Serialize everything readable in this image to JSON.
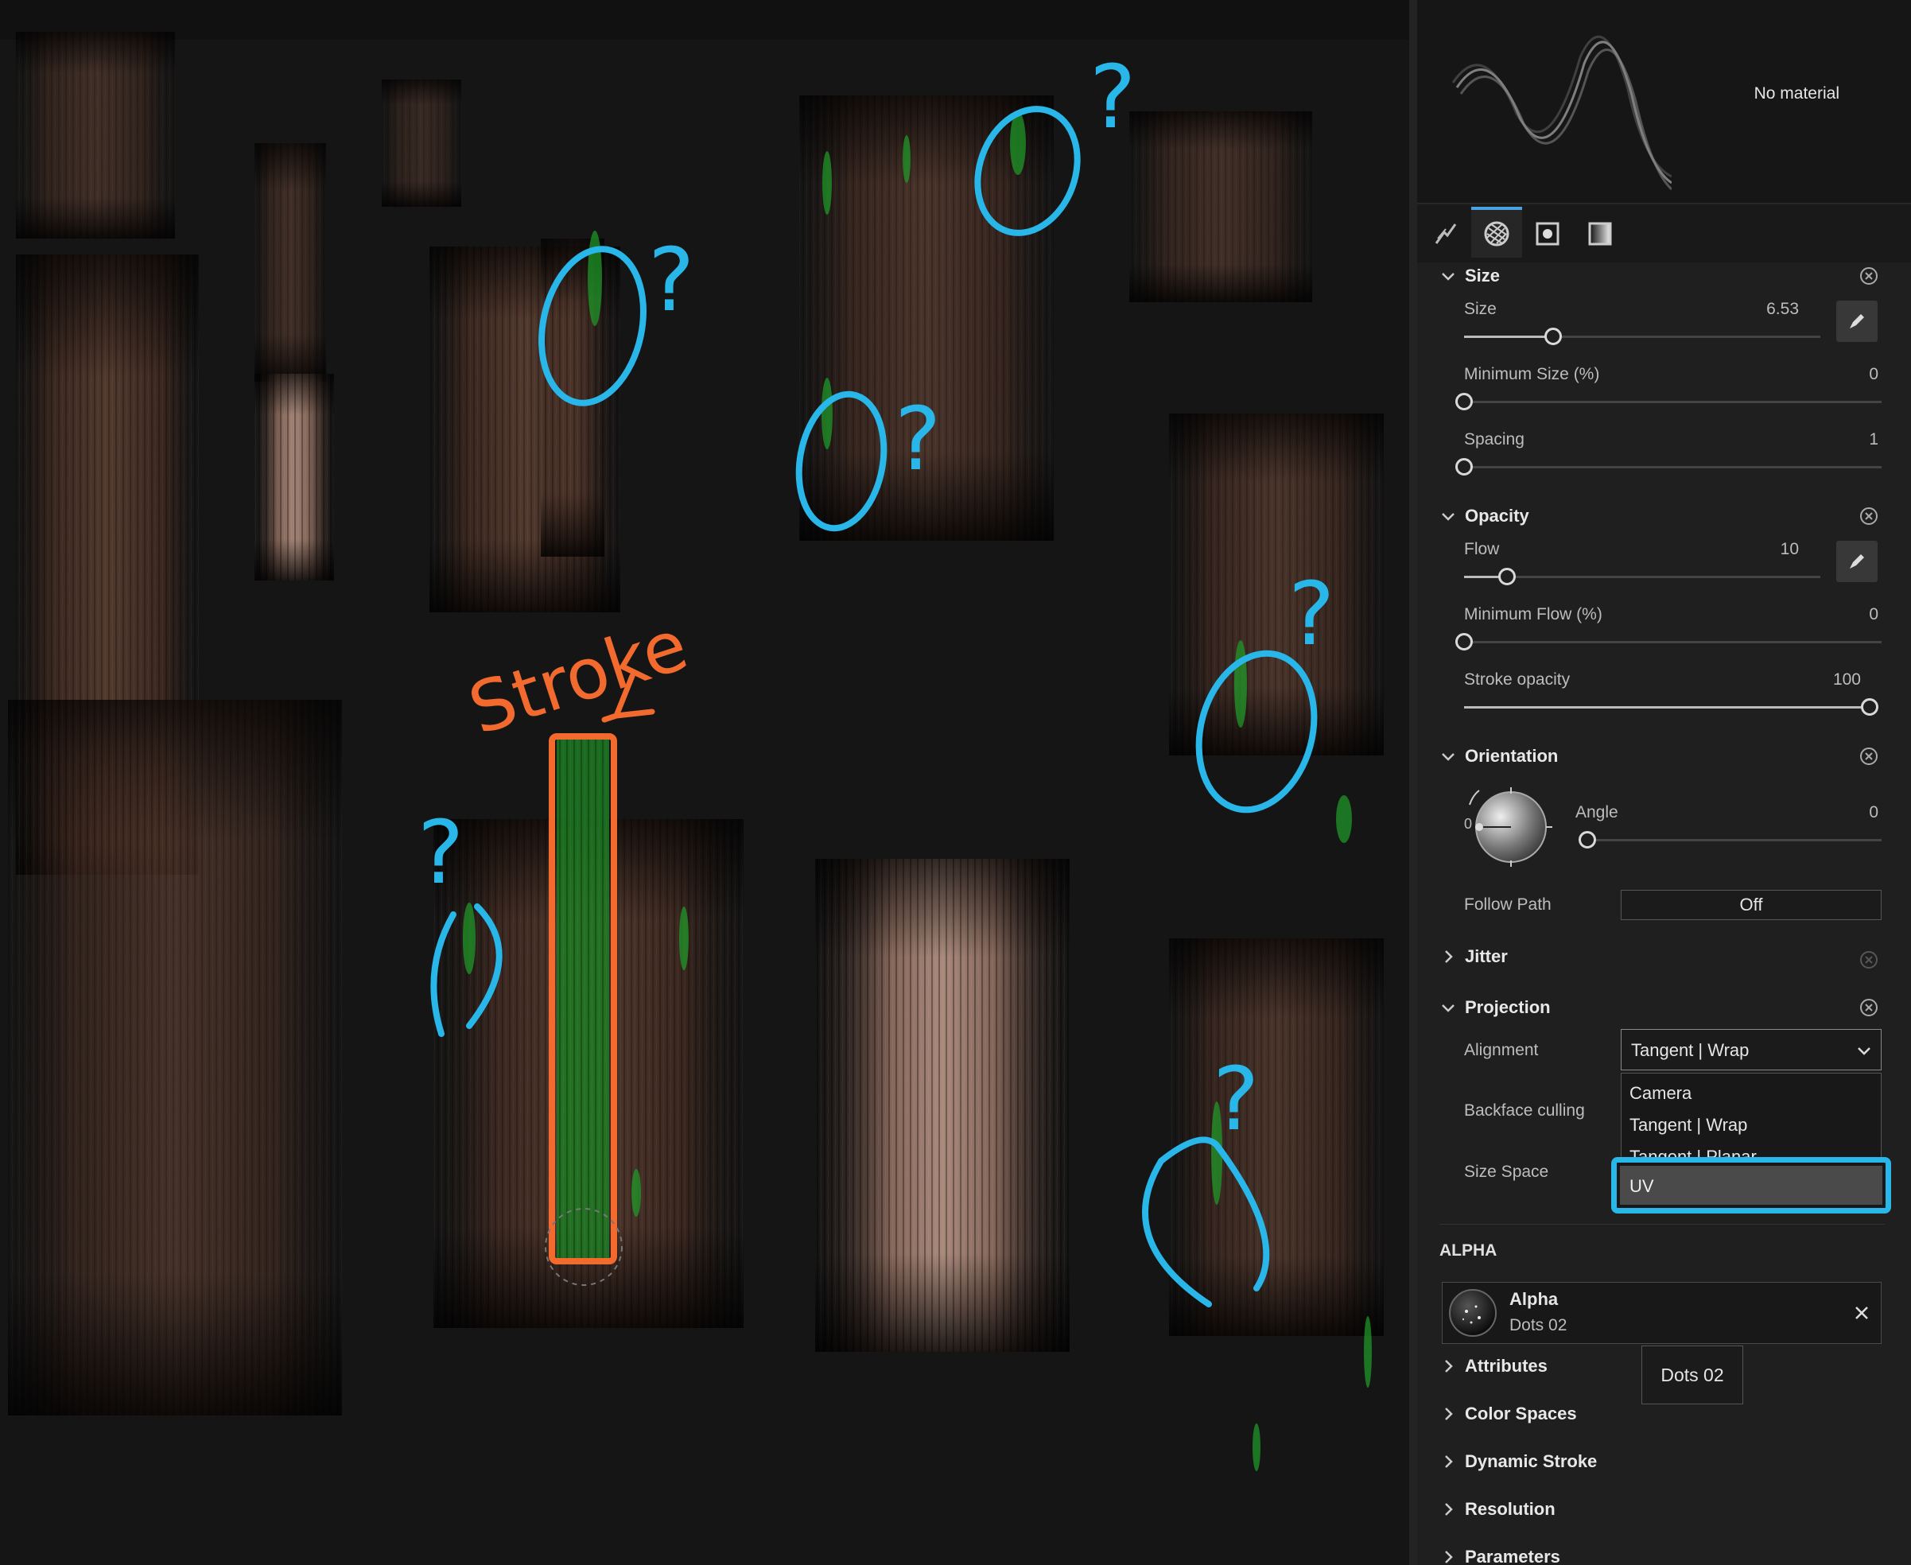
{
  "annotations": {
    "stroke_label": "Stroke",
    "question_mark": "?"
  },
  "preview": {
    "material_label": "No material"
  },
  "tabs": [
    {
      "name": "stroke-tab-icon",
      "active": false
    },
    {
      "name": "material-tab-icon",
      "active": true
    },
    {
      "name": "alpha-tab-icon",
      "active": false
    },
    {
      "name": "gradient-tab-icon",
      "active": false
    }
  ],
  "size_section": {
    "title": "Size",
    "size_label": "Size",
    "size_value": "6.53",
    "size_fraction": 0.25,
    "min_size_label": "Minimum Size (%)",
    "min_size_value": "0",
    "min_size_fraction": 0,
    "spacing_label": "Spacing",
    "spacing_value": "1",
    "spacing_fraction": 0
  },
  "opacity_section": {
    "title": "Opacity",
    "flow_label": "Flow",
    "flow_value": "10",
    "flow_fraction": 0.12,
    "min_flow_label": "Minimum Flow (%)",
    "min_flow_value": "0",
    "min_flow_fraction": 0,
    "stroke_opacity_label": "Stroke opacity",
    "stroke_opacity_value": "100",
    "stroke_opacity_fraction": 1
  },
  "orientation_section": {
    "title": "Orientation",
    "dial_value": "0",
    "angle_label": "Angle",
    "angle_value": "0",
    "angle_fraction": 0,
    "follow_path_label": "Follow Path",
    "follow_path_value": "Off"
  },
  "jitter_section": {
    "title": "Jitter"
  },
  "projection_section": {
    "title": "Projection",
    "alignment_label": "Alignment",
    "alignment_value": "Tangent | Wrap",
    "backface_label": "Backface culling",
    "size_space_label": "Size Space",
    "options": [
      "Camera",
      "Tangent | Wrap",
      "Tangent | Planar",
      "UV"
    ],
    "highlighted_option": "UV"
  },
  "alpha_section": {
    "title": "ALPHA",
    "card_title": "Alpha",
    "card_subtitle": "Dots 02",
    "tooltip": "Dots 02"
  },
  "collapsed_sections": [
    "Attributes",
    "Color Spaces",
    "Dynamic Stroke",
    "Resolution",
    "Parameters"
  ],
  "colors": {
    "accent": "#29b6e9",
    "annotation_blue": "#29b6e9",
    "annotation_orange": "#f26a2e",
    "paint_green": "#1f9e2a"
  }
}
